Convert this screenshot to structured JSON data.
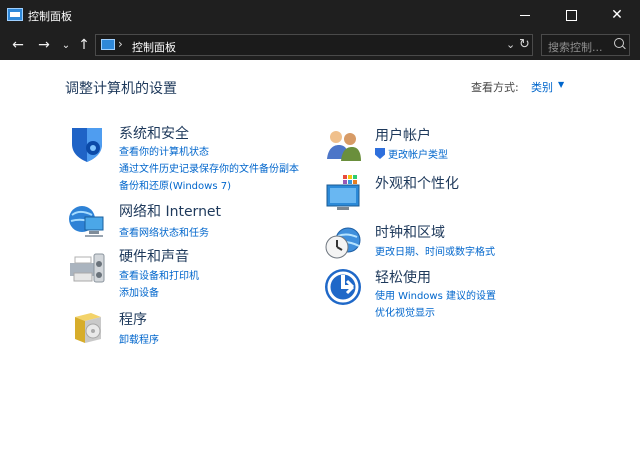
{
  "window": {
    "title": "控制面板",
    "minimize": "",
    "maximize": "",
    "close": "✕"
  },
  "navigation": {
    "back": "←",
    "forward": "→",
    "history": "⌄",
    "up": "↑",
    "address_separator": "›",
    "address_text": "控制面板",
    "address_dropdown": "⌄",
    "refresh": "↻",
    "search_placeholder": "搜索控制..."
  },
  "content": {
    "heading": "调整计算机的设置",
    "view_by_label": "查看方式:",
    "view_by_value": "类别",
    "view_by_caret": "▼",
    "left_categories": [
      {
        "title": "系统和安全",
        "links": [
          "查看你的计算机状态",
          "通过文件历史记录保存你的文件备份副本",
          "备份和还原(Windows 7)"
        ]
      },
      {
        "title": "网络和 Internet",
        "links": [
          "查看网络状态和任务"
        ]
      },
      {
        "title": "硬件和声音",
        "links": [
          "查看设备和打印机",
          "添加设备"
        ]
      },
      {
        "title": "程序",
        "links": [
          "卸载程序"
        ]
      }
    ],
    "right_categories": [
      {
        "title": "用户帐户",
        "links": [
          "更改帐户类型"
        ]
      },
      {
        "title": "外观和个性化",
        "links": []
      },
      {
        "title": "时钟和区域",
        "links": [
          "更改日期、时间或数字格式"
        ]
      },
      {
        "title": "轻松使用",
        "links": [
          "使用 Windows 建议的设置",
          "优化视觉显示"
        ]
      }
    ]
  }
}
